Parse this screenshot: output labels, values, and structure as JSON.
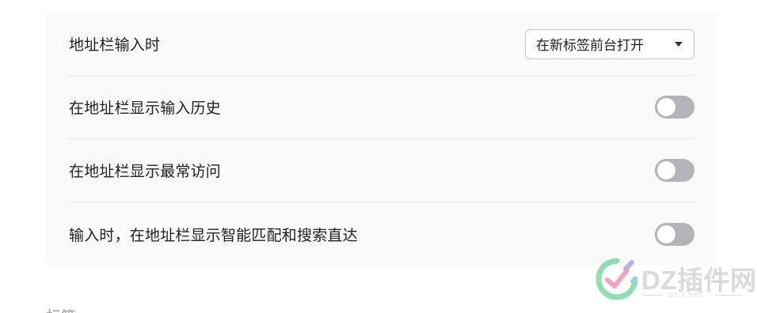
{
  "settings": {
    "rows": [
      {
        "label": "地址栏输入时",
        "control": "select",
        "value": "在新标签前台打开"
      },
      {
        "label": "在地址栏显示输入历史",
        "control": "toggle",
        "on": false
      },
      {
        "label": "在地址栏显示最常访问",
        "control": "toggle",
        "on": false
      },
      {
        "label": "输入时，在地址栏显示智能匹配和搜索直达",
        "control": "toggle",
        "on": false
      }
    ]
  },
  "next_section": {
    "heading_partial": "标签"
  },
  "watermark": {
    "text": "DZ插件网",
    "domain": "DZ-X.NET"
  },
  "colors": {
    "card_background": "#fafafb",
    "divider": "#e6e6e9",
    "toggle_off": "#b4b4b8",
    "watermark_green": "#3cc37a",
    "watermark_pink": "#e85a8c",
    "watermark_purple": "#8a6fd8",
    "watermark_blue": "#4aa3e8"
  }
}
